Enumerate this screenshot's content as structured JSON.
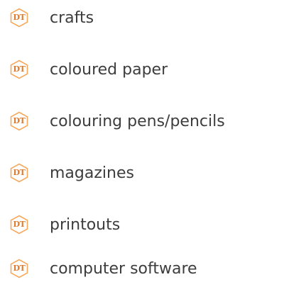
{
  "badge": {
    "text": "DT",
    "icon": "dt-hexagon-icon",
    "outline_color": "#f6a75a",
    "text_color": "#e07a2a"
  },
  "items": [
    {
      "label": "crafts"
    },
    {
      "label": "coloured paper"
    },
    {
      "label": "colouring pens/pencils"
    },
    {
      "label": "magazines"
    },
    {
      "label": "printouts"
    },
    {
      "label": "computer software"
    }
  ]
}
